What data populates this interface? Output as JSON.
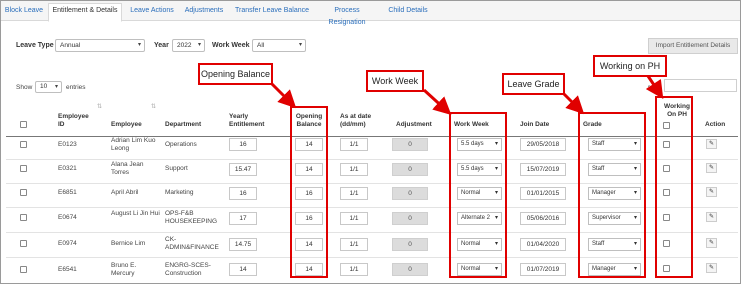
{
  "tabs": [
    {
      "label": "Block Leave",
      "active": false
    },
    {
      "label": "Entitlement & Details",
      "active": true
    },
    {
      "label": "Leave Actions",
      "active": false
    },
    {
      "label": "Adjustments",
      "active": false
    },
    {
      "label": "Transfer Leave Balance",
      "active": false
    },
    {
      "label": "Process Resignation",
      "active": false
    },
    {
      "label": "Child Details",
      "active": false
    }
  ],
  "filters": {
    "leave_type_label": "Leave Type",
    "leave_type_value": "Annual",
    "year_label": "Year",
    "year_value": "2022",
    "work_week_label": "Work Week",
    "work_week_value": "All"
  },
  "import_button": "Import Entitlement Details",
  "show_label": "Show",
  "show_value": "10",
  "entries_label": "entries",
  "search_label": "rch:",
  "headers": {
    "employee_id": [
      "Employee",
      "ID"
    ],
    "employee": "Employee",
    "department": "Department",
    "yearly": [
      "Yearly",
      "Entitlement"
    ],
    "opening": [
      "Opening",
      "Balance"
    ],
    "as_at": [
      "As at date",
      "(dd/mm)"
    ],
    "adjustment": "Adjustment",
    "work_week": "Work Week",
    "join_date": "Join Date",
    "grade": "Grade",
    "working_ph": [
      "Working",
      "On PH"
    ],
    "action": "Action"
  },
  "rows": [
    {
      "id": "E0123",
      "name": [
        "Adrian Lim Kuo",
        "Leong"
      ],
      "dept": [
        "Operations"
      ],
      "yearly": "16",
      "opening": "14",
      "as_at": "1/1",
      "adjustment": "0",
      "work_week": "5.5 days",
      "join_date": "29/05/2018",
      "grade": "Staff"
    },
    {
      "id": "E0321",
      "name": [
        "Alana Jean",
        "Torres"
      ],
      "dept": [
        "Support"
      ],
      "yearly": "15.47",
      "opening": "14",
      "as_at": "1/1",
      "adjustment": "0",
      "work_week": "5.5 days",
      "join_date": "15/07/2019",
      "grade": "Staff"
    },
    {
      "id": "E6851",
      "name": [
        "April Abril"
      ],
      "dept": [
        "Marketing"
      ],
      "yearly": "16",
      "opening": "16",
      "as_at": "1/1",
      "adjustment": "0",
      "work_week": "Normal",
      "join_date": "01/01/2015",
      "grade": "Manager"
    },
    {
      "id": "E0674",
      "name": [
        "August Li Jin Hui"
      ],
      "dept": [
        "OPS-F&B",
        "HOUSEKEEPING"
      ],
      "yearly": "17",
      "opening": "16",
      "as_at": "1/1",
      "adjustment": "0",
      "work_week": "Alternate 2",
      "join_date": "05/06/2016",
      "grade": "Supervisor"
    },
    {
      "id": "E0974",
      "name": [
        "Bernice Lim"
      ],
      "dept": [
        "CK-",
        "ADMIN&FINANCE"
      ],
      "yearly": "14.75",
      "opening": "14",
      "as_at": "1/1",
      "adjustment": "0",
      "work_week": "Normal",
      "join_date": "01/04/2020",
      "grade": "Staff"
    },
    {
      "id": "E6541",
      "name": [
        "Bruno E.",
        "Mercury"
      ],
      "dept": [
        "ENGRG-SCES-",
        "Construction"
      ],
      "yearly": "14",
      "opening": "14",
      "as_at": "1/1",
      "adjustment": "0",
      "work_week": "Normal",
      "join_date": "01/07/2019",
      "grade": "Manager"
    }
  ],
  "callouts": {
    "opening_balance": "Opening Balance",
    "work_week": "Work Week",
    "leave_grade": "Leave Grade",
    "working_on_ph": "Working on PH"
  },
  "colors": {
    "annotation": "#e00000",
    "link": "#2a6ebb"
  }
}
